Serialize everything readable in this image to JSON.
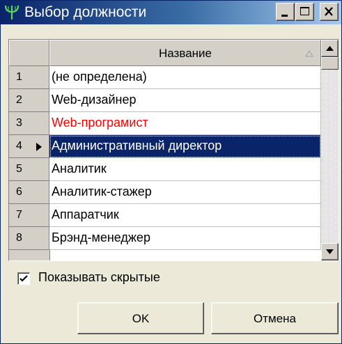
{
  "window": {
    "title": "Выбор должности",
    "icon": "pitchfork-app-icon"
  },
  "titlebar_buttons": [
    "minimize-icon",
    "maximize-icon",
    "close-icon"
  ],
  "grid": {
    "column_header": "Название",
    "rows": [
      {
        "num": "1",
        "name": "(не определена)"
      },
      {
        "num": "2",
        "name": "Web-дизайнер"
      },
      {
        "num": "3",
        "name": "Web-програмист",
        "color": "#ff0000"
      },
      {
        "num": "4",
        "name": "Административный директор",
        "selected": true
      },
      {
        "num": "5",
        "name": "Аналитик"
      },
      {
        "num": "6",
        "name": "Аналитик-стажер"
      },
      {
        "num": "7",
        "name": "Аппаратчик"
      },
      {
        "num": "8",
        "name": "Брэнд-менеджер"
      }
    ]
  },
  "show_hidden": {
    "label": "Показывать скрытые",
    "checked": true
  },
  "buttons": {
    "ok": "OK",
    "cancel": "Отмена"
  },
  "colors": {
    "selection": "#0a246a",
    "highlight_text": "#ff0000",
    "titlebar_start": "#0a246a",
    "titlebar_end": "#a6caf0"
  }
}
